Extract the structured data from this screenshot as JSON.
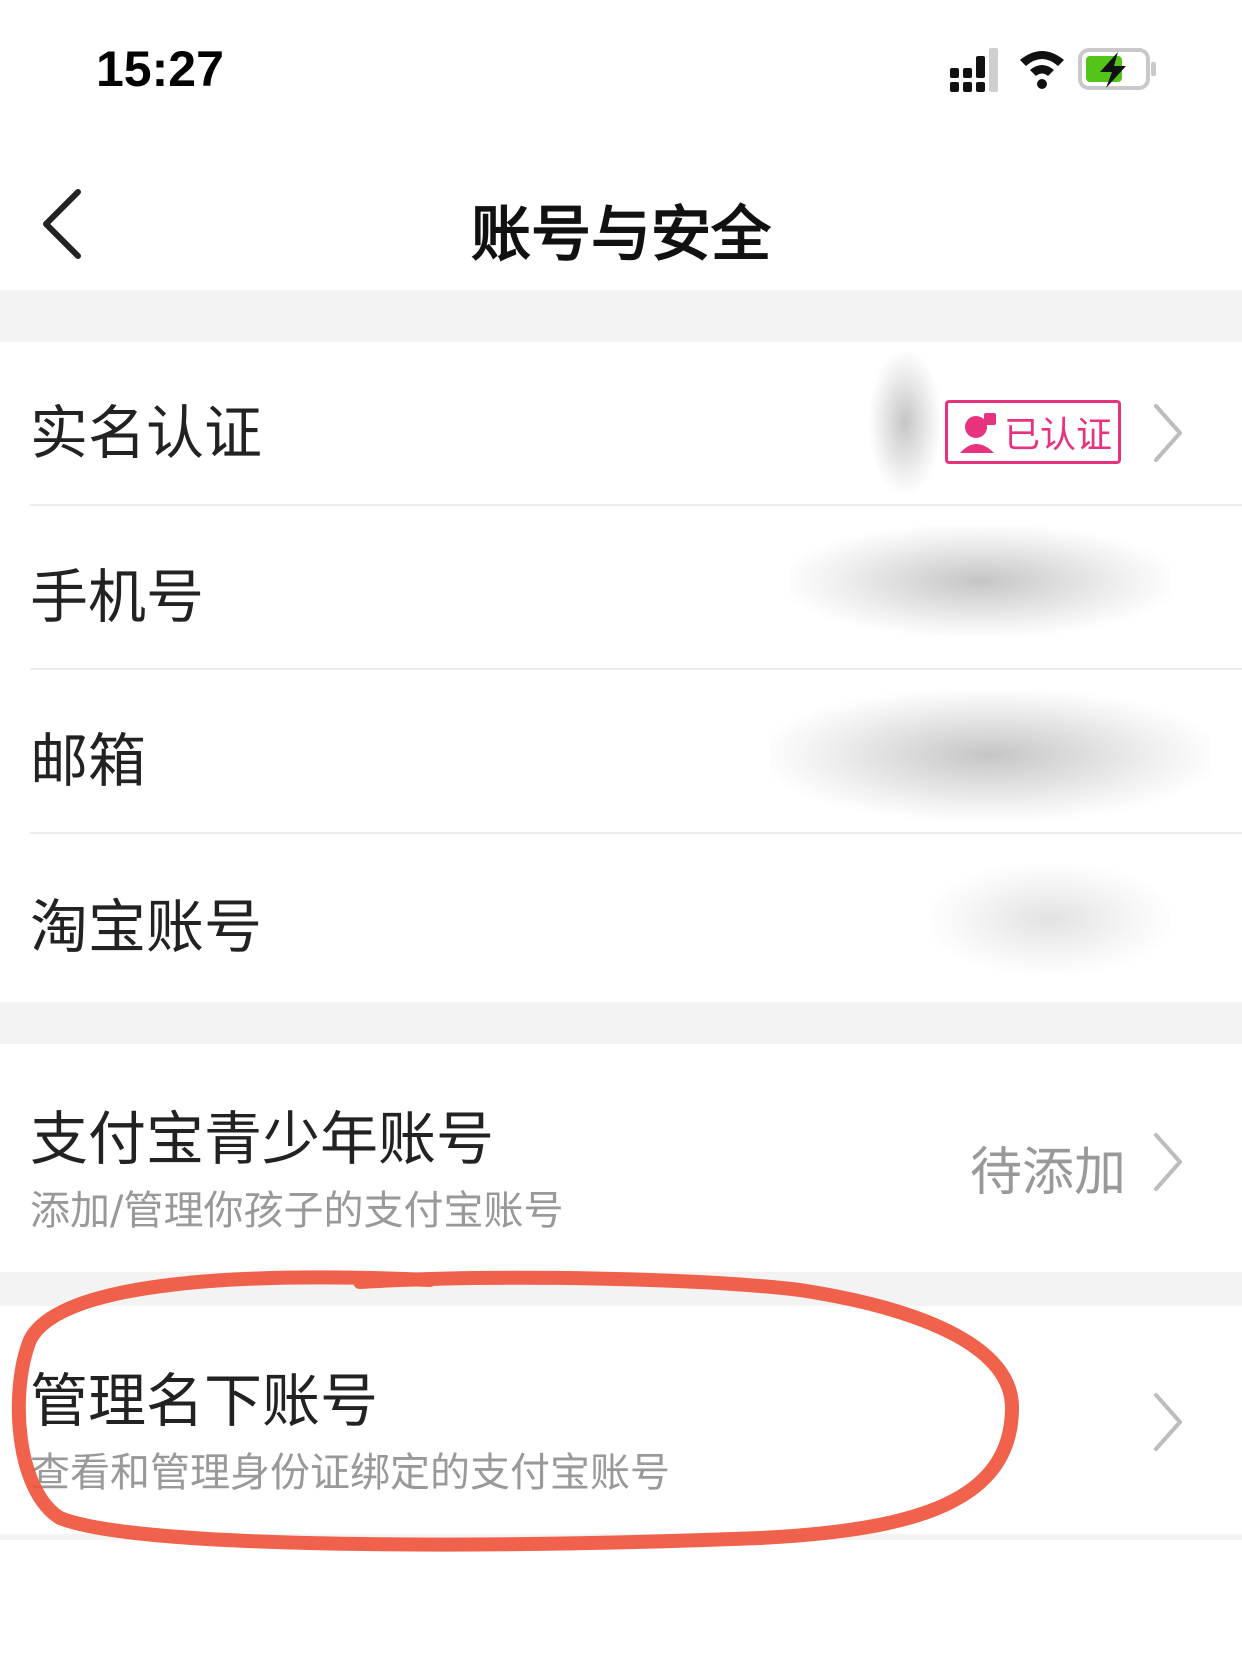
{
  "status_bar": {
    "time": "15:27"
  },
  "nav": {
    "title": "账号与安全"
  },
  "rows": {
    "real_name": {
      "label": "实名认证",
      "badge": "已认证"
    },
    "phone": {
      "label": "手机号"
    },
    "email": {
      "label": "邮箱"
    },
    "taobao": {
      "label": "淘宝账号"
    },
    "teen": {
      "label": "支付宝青少年账号",
      "sub": "添加/管理你孩子的支付宝账号",
      "value": "待添加"
    },
    "manage": {
      "label": "管理名下账号",
      "sub": "查看和管理身份证绑定的支付宝账号"
    }
  },
  "colors": {
    "badge": "#e8327d",
    "highlight": "#f0513a",
    "muted": "#999999"
  }
}
